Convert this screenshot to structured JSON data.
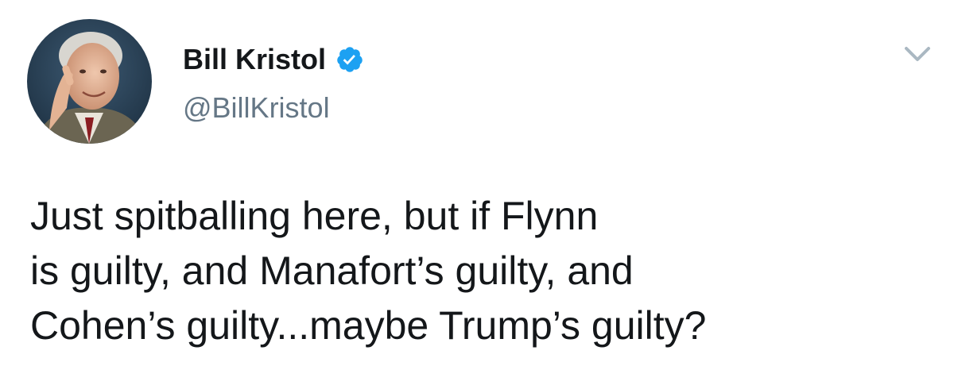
{
  "tweet": {
    "author": {
      "display_name": "Bill Kristol",
      "handle": "@BillKristol",
      "verified": true,
      "avatar_icon": "profile-photo"
    },
    "text_lines": [
      "Just spitballing here, but if Flynn",
      "is guilty, and Manafort’s guilty, and",
      "Cohen’s guilty...maybe Trump’s guilty?"
    ],
    "icons": {
      "verified": "verified-badge-icon",
      "menu": "chevron-down-icon"
    }
  },
  "colors": {
    "text": "#14171a",
    "secondary": "#657786",
    "verified_blue": "#1da1f2",
    "caret": "#aab8c2"
  }
}
